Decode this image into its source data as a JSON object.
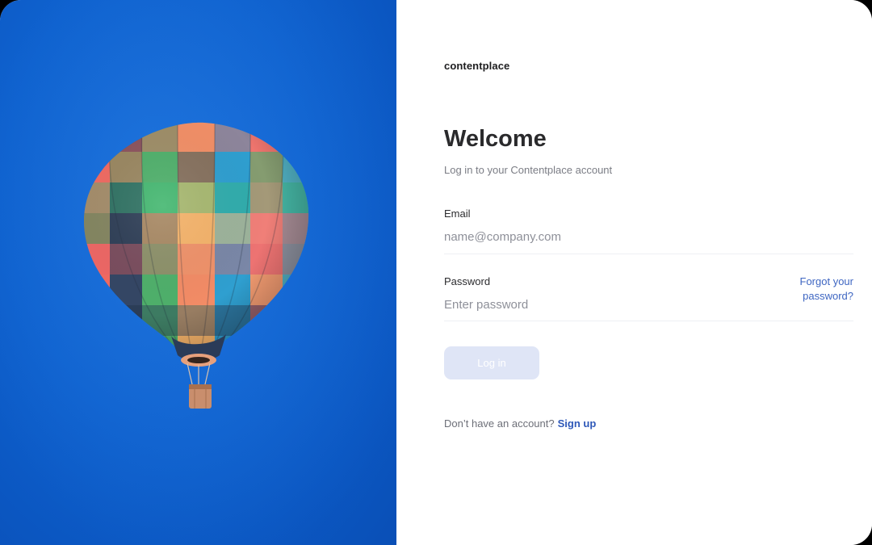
{
  "brand": {
    "name": "contentplace"
  },
  "login": {
    "title": "Welcome",
    "subtitle": "Log in to your Contentplace account",
    "email_label": "Email",
    "email_placeholder": "name@company.com",
    "email_value": "",
    "password_label": "Password",
    "password_placeholder": "Enter password",
    "password_value": "",
    "forgot_line1": "Forgot your",
    "forgot_line2": "password?",
    "login_button": "Log in",
    "signup_prompt": "Don’t have an account?",
    "signup_link": "Sign up"
  },
  "hero": {
    "image_icon": "hot-air-balloon-photo"
  },
  "colors": {
    "hero_sky": "#0f62cf",
    "accent_link": "#3e66c2",
    "signup_link": "#2e58b8",
    "button_disabled_bg": "#dfe5f6",
    "title_text": "#2a2a2c",
    "muted_text": "#7b7d85"
  }
}
